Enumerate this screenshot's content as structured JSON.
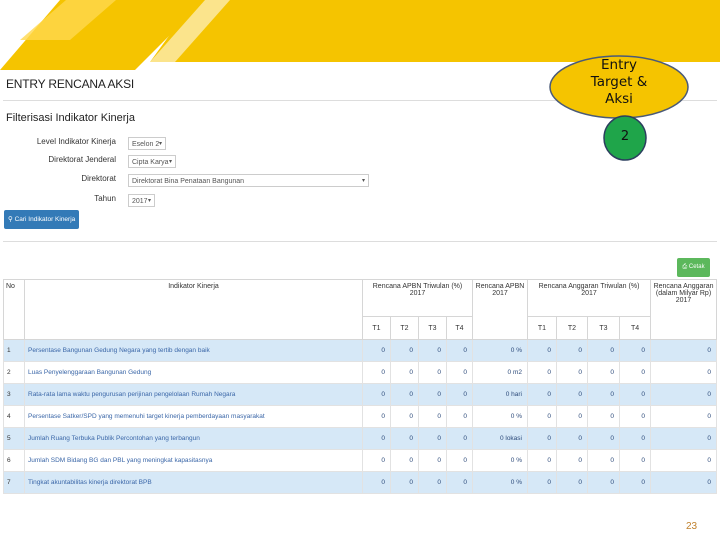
{
  "colors": {
    "accent": "#f5c400",
    "primary": "#337ab7",
    "success": "#5cb85c",
    "row_highlight": "#d6e8f7",
    "callout_fill": "#f5c400",
    "badge_fill": "#1fa54a",
    "page_number": "#c0812c"
  },
  "page": {
    "title": "ENTRY RENCANA AKSI",
    "number": "23"
  },
  "callout": {
    "line1": "Entry",
    "line2": "Target &",
    "line3": "Aksi",
    "badge": "2"
  },
  "filter": {
    "title": "Filterisasi Indikator Kinerja",
    "fields": [
      {
        "label": "Level Indikator Kinerja",
        "value": "Eselon 2"
      },
      {
        "label": "Direktorat Jenderal",
        "value": "Cipta Karya"
      },
      {
        "label": "Direktorat",
        "value": "Direktorat Bina Penataan Bangunan"
      },
      {
        "label": "Tahun",
        "value": "2017"
      }
    ],
    "search_button": "Cari Indikator Kinerja",
    "search_icon": "search-icon"
  },
  "print_button": "Cetak",
  "print_icon": "printer-icon",
  "table": {
    "headers": {
      "no": "No",
      "indikator": "Indikator Kinerja",
      "rencana_apbn_triwulan": "Rencana APBN Triwulan (%) 2017",
      "rencana_apbn": "Rencana APBN 2017",
      "rencana_anggaran_triwulan": "Rencana Anggaran Triwulan (%) 2017",
      "rencana_anggaran": "Rencana Anggaran (dalam Milyar Rp) 2017",
      "t1": "T1",
      "t2": "T2",
      "t3": "T3",
      "t4": "T4"
    },
    "rows": [
      {
        "no": "1",
        "indikator": "Persentase Bangunan Gedung Negara yang tertib dengan baik",
        "t1": "0",
        "t2": "0",
        "t3": "0",
        "t4": "0",
        "apbn": "0 %",
        "a1": "0",
        "a2": "0",
        "a3": "0",
        "a4": "0",
        "anggaran": "0"
      },
      {
        "no": "2",
        "indikator": "Luas Penyelenggaraan Bangunan Gedung",
        "t1": "0",
        "t2": "0",
        "t3": "0",
        "t4": "0",
        "apbn": "0 m2",
        "a1": "0",
        "a2": "0",
        "a3": "0",
        "a4": "0",
        "anggaran": "0"
      },
      {
        "no": "3",
        "indikator": "Rata-rata lama waktu pengurusan perijinan pengelolaan Rumah Negara",
        "t1": "0",
        "t2": "0",
        "t3": "0",
        "t4": "0",
        "apbn": "0 hari",
        "a1": "0",
        "a2": "0",
        "a3": "0",
        "a4": "0",
        "anggaran": "0"
      },
      {
        "no": "4",
        "indikator": "Persentase Satker/SPD yang memenuhi target kinerja pemberdayaan masyarakat",
        "t1": "0",
        "t2": "0",
        "t3": "0",
        "t4": "0",
        "apbn": "0 %",
        "a1": "0",
        "a2": "0",
        "a3": "0",
        "a4": "0",
        "anggaran": "0"
      },
      {
        "no": "5",
        "indikator": "Jumlah Ruang Terbuka Publik Percontohan yang terbangun",
        "t1": "0",
        "t2": "0",
        "t3": "0",
        "t4": "0",
        "apbn": "0 lokasi",
        "a1": "0",
        "a2": "0",
        "a3": "0",
        "a4": "0",
        "anggaran": "0"
      },
      {
        "no": "6",
        "indikator": "Jumlah SDM Bidang BG dan PBL yang meningkat kapasitasnya",
        "t1": "0",
        "t2": "0",
        "t3": "0",
        "t4": "0",
        "apbn": "0 %",
        "a1": "0",
        "a2": "0",
        "a3": "0",
        "a4": "0",
        "anggaran": "0"
      },
      {
        "no": "7",
        "indikator": "Tingkat akuntabilitas kinerja direktorat BPB",
        "t1": "0",
        "t2": "0",
        "t3": "0",
        "t4": "0",
        "apbn": "0 %",
        "a1": "0",
        "a2": "0",
        "a3": "0",
        "a4": "0",
        "anggaran": "0"
      }
    ]
  }
}
